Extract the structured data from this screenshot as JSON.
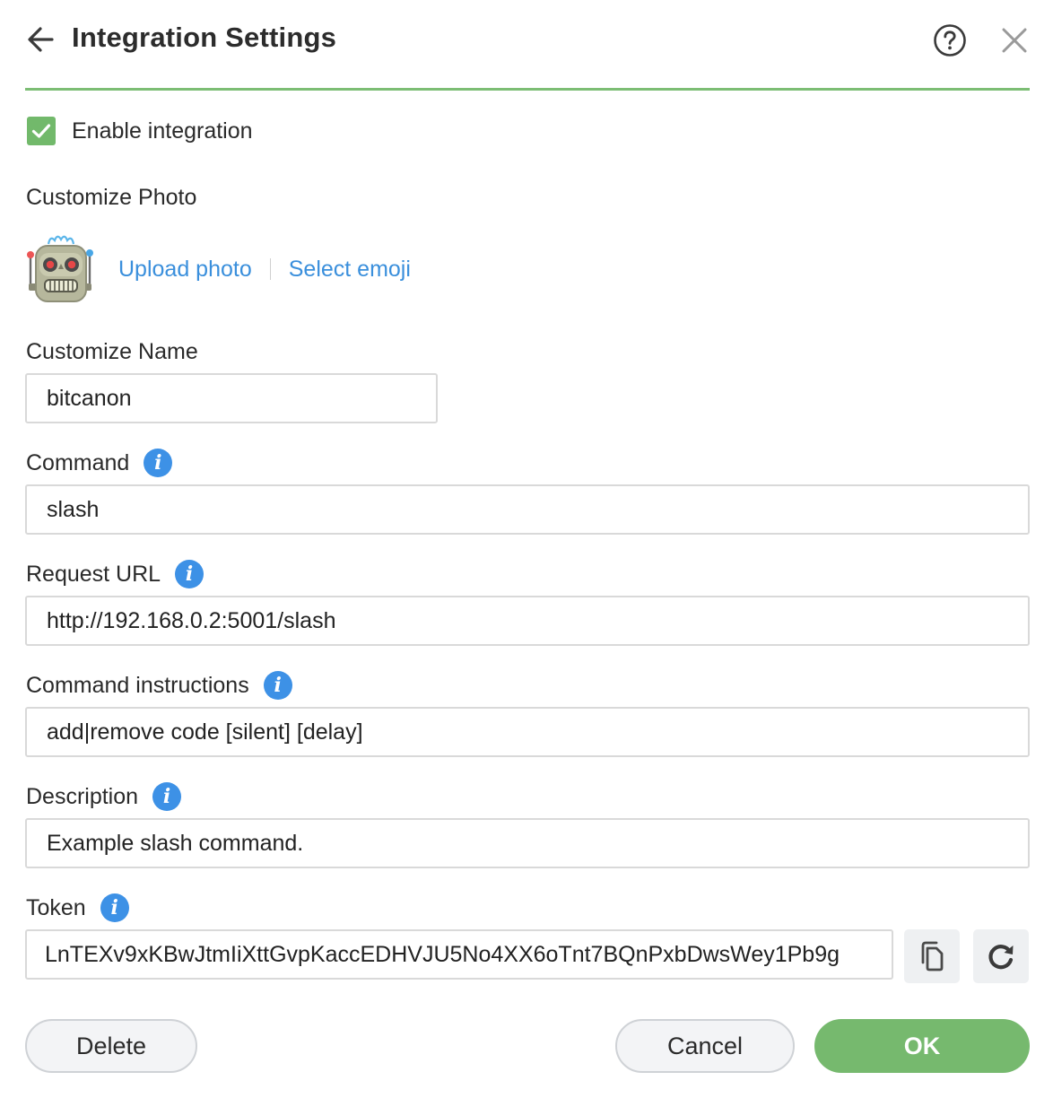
{
  "header": {
    "title": "Integration Settings",
    "accent_color": "#7cbd74",
    "icons": {
      "back": "arrow-left-icon",
      "help": "question-circle-icon",
      "close": "close-x-icon"
    }
  },
  "enable": {
    "label": "Enable integration",
    "checked": true
  },
  "photo": {
    "label": "Customize Photo",
    "avatar": "robot-emoji",
    "upload_label": "Upload photo",
    "emoji_label": "Select emoji"
  },
  "fields": {
    "name": {
      "label": "Customize Name",
      "value": "bitcanon"
    },
    "command": {
      "label": "Command",
      "value": "slash"
    },
    "request_url": {
      "label": "Request URL",
      "value": "http://192.168.0.2:5001/slash"
    },
    "instructions": {
      "label": "Command instructions",
      "value": "add|remove code [silent] [delay]"
    },
    "description": {
      "label": "Description",
      "value": "Example slash command."
    },
    "token": {
      "label": "Token",
      "value": "LnTEXv9xKBwJtmIiXttGvpKaccEDHVJU5No4XX6oTnt7BQnPxbDwsWey1Pb9g"
    }
  },
  "footer": {
    "delete_label": "Delete",
    "cancel_label": "Cancel",
    "ok_label": "OK",
    "primary_color": "#76b96e"
  },
  "link_color": "#3a8fdc",
  "info_icon_color": "#3d91e6"
}
